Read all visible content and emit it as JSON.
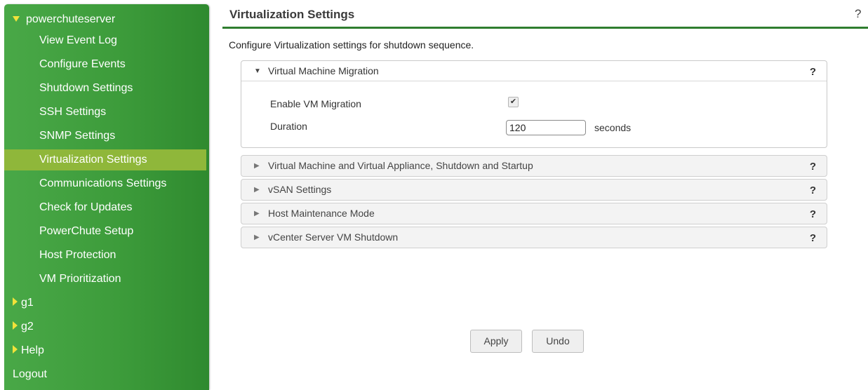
{
  "sidebar": {
    "server_label": "powerchuteserver",
    "items": [
      {
        "label": "View Event Log"
      },
      {
        "label": "Configure Events"
      },
      {
        "label": "Shutdown Settings"
      },
      {
        "label": "SSH Settings"
      },
      {
        "label": "SNMP Settings"
      },
      {
        "label": "Virtualization Settings",
        "selected": true
      },
      {
        "label": "Communications Settings"
      },
      {
        "label": "Check for Updates"
      },
      {
        "label": "PowerChute Setup"
      },
      {
        "label": "Host Protection"
      },
      {
        "label": "VM Prioritization"
      }
    ],
    "groups": [
      {
        "label": "g1"
      },
      {
        "label": "g2"
      },
      {
        "label": "Help"
      }
    ],
    "logout_label": "Logout",
    "colors": {
      "background": "#3e9e3e",
      "selected": "#8fb73a",
      "triangle": "#f2e23a"
    }
  },
  "main": {
    "title": "Virtualization Settings",
    "help_symbol": "?",
    "intro": "Configure Virtualization settings for shutdown sequence.",
    "panels": [
      {
        "title": "Virtual Machine Migration",
        "expanded": true,
        "help": "?"
      },
      {
        "title": "Virtual Machine and Virtual Appliance, Shutdown and Startup",
        "expanded": false,
        "help": "?"
      },
      {
        "title": "vSAN Settings",
        "expanded": false,
        "help": "?"
      },
      {
        "title": "Host Maintenance Mode",
        "expanded": false,
        "help": "?"
      },
      {
        "title": "vCenter Server VM Shutdown",
        "expanded": false,
        "help": "?"
      }
    ],
    "migration": {
      "enable_label": "Enable VM Migration",
      "enable_checked": true,
      "duration_label": "Duration",
      "duration_value": "120",
      "duration_unit": "seconds"
    },
    "buttons": {
      "apply": "Apply",
      "undo": "Undo"
    }
  }
}
